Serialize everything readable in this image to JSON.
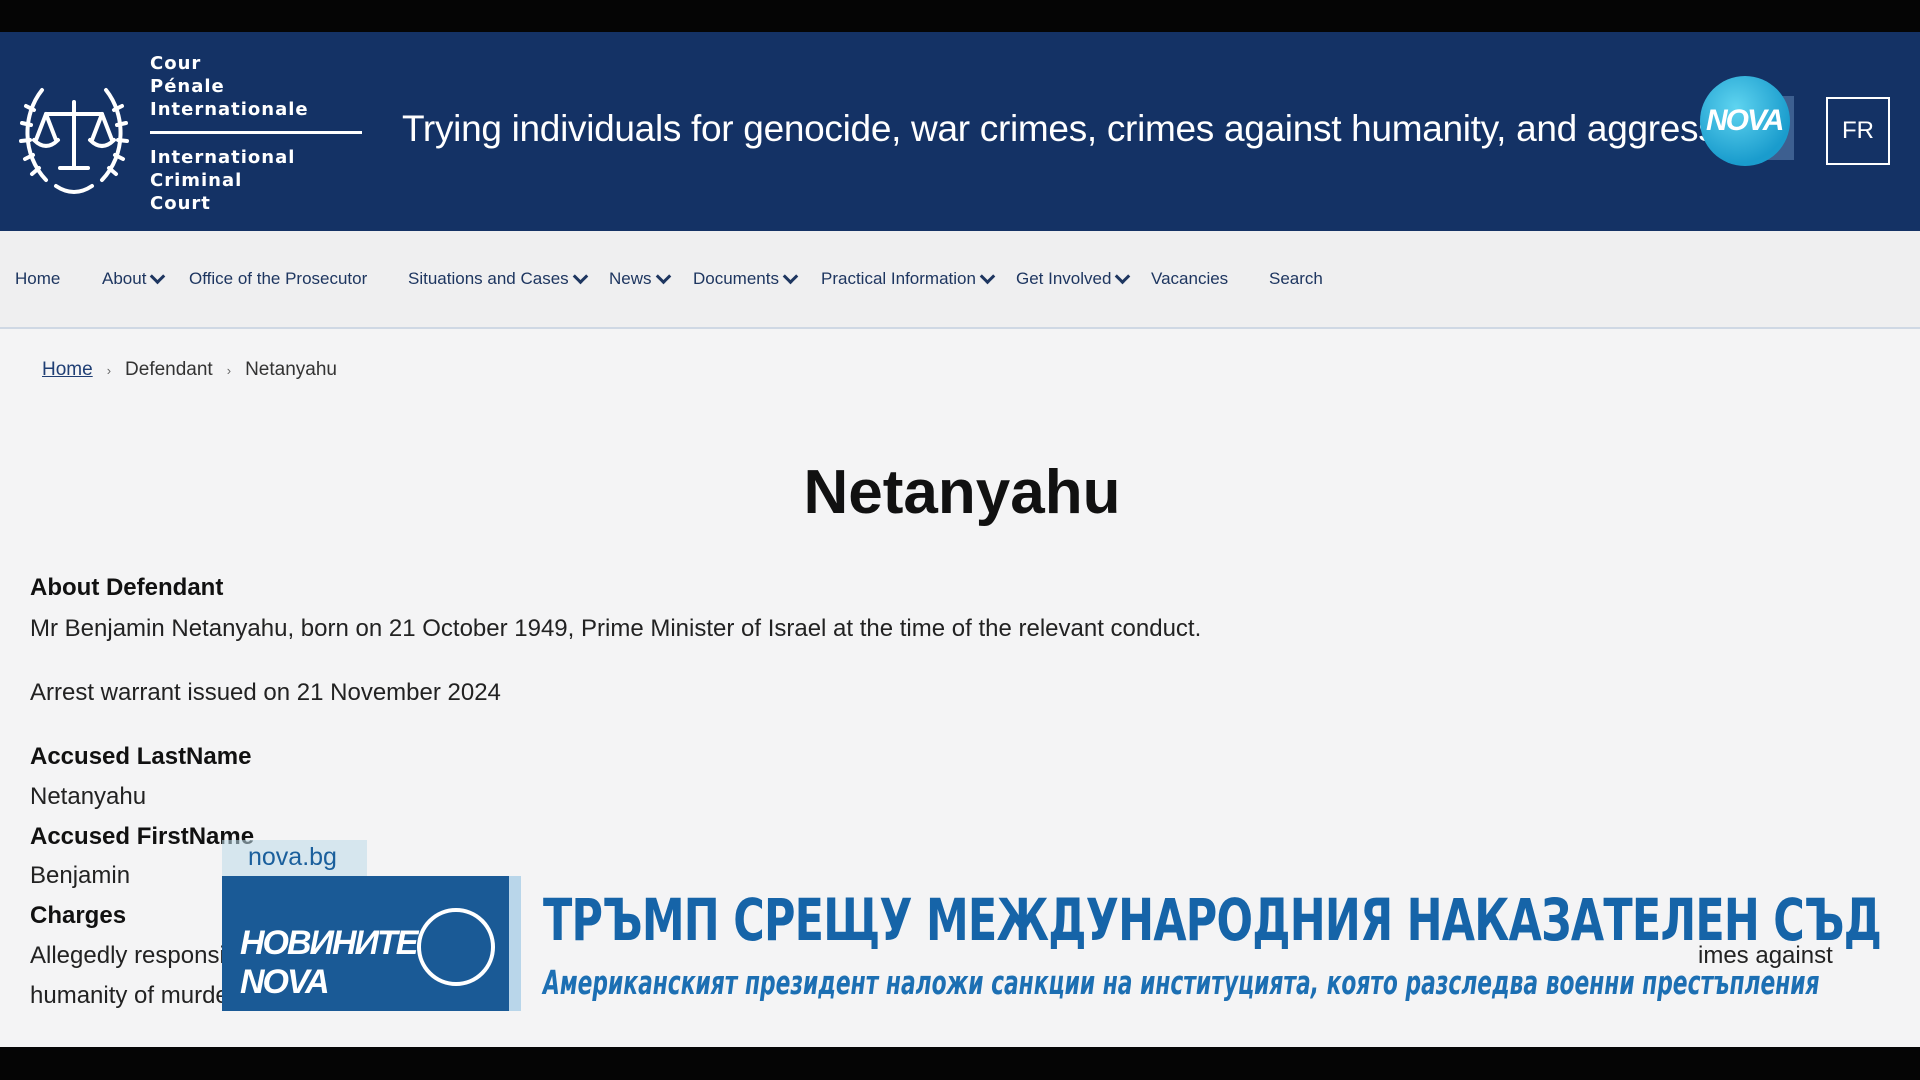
{
  "header": {
    "org_fr": [
      "Cour",
      "Pénale",
      "Internationale"
    ],
    "org_en": [
      "International",
      "Criminal",
      "Court"
    ],
    "tagline": "Trying individuals for genocide, war crimes, crimes against humanity, and aggression",
    "language_button": "FR",
    "channel_logo": "NOVA",
    "emblem_icon": "scales-of-justice-icon"
  },
  "nav": {
    "items": [
      {
        "label": "Home",
        "dropdown": false
      },
      {
        "label": "About",
        "dropdown": true
      },
      {
        "label": "Office of the Prosecutor",
        "dropdown": false
      },
      {
        "label": "Situations and Cases",
        "dropdown": true
      },
      {
        "label": "News",
        "dropdown": true
      },
      {
        "label": "Documents",
        "dropdown": true
      },
      {
        "label": "Practical Information",
        "dropdown": true
      },
      {
        "label": "Get Involved",
        "dropdown": true
      },
      {
        "label": "Vacancies",
        "dropdown": false
      },
      {
        "label": "Search",
        "dropdown": false
      }
    ]
  },
  "breadcrumb": [
    "Home",
    "Defendant",
    "Netanyahu"
  ],
  "page": {
    "title": "Netanyahu",
    "about_heading": "About Defendant",
    "about_text": "Mr Benjamin Netanyahu, born on 21 October 1949, Prime Minister of Israel at the time of the relevant conduct.",
    "warrant_text": "Arrest warrant issued on 21 November 2024",
    "lastname_heading": "Accused LastName",
    "lastname_value": "Netanyahu",
    "firstname_heading": "Accused FirstName",
    "firstname_value": "Benjamin",
    "charges_heading": "Charges",
    "charges_line1_start": "Allegedly responsi",
    "charges_line1_end": "imes against",
    "charges_line2": "humanity of murde"
  },
  "overlay": {
    "site": "nova.bg",
    "logo_text": "НОВИНИТЕ NOVA",
    "headline": "ТРЪМП СРЕЩУ МЕЖДУНАРОДНИЯ НАКАЗАТЕЛЕН СЪД",
    "subline": "Американският президент наложи санкции на институцията, която разследва военни престъпления"
  },
  "colors": {
    "header_bg": "#143265",
    "nav_text": "#1e3660",
    "overlay_blue": "#1a5a96",
    "headline_blue": "#1664a8"
  }
}
